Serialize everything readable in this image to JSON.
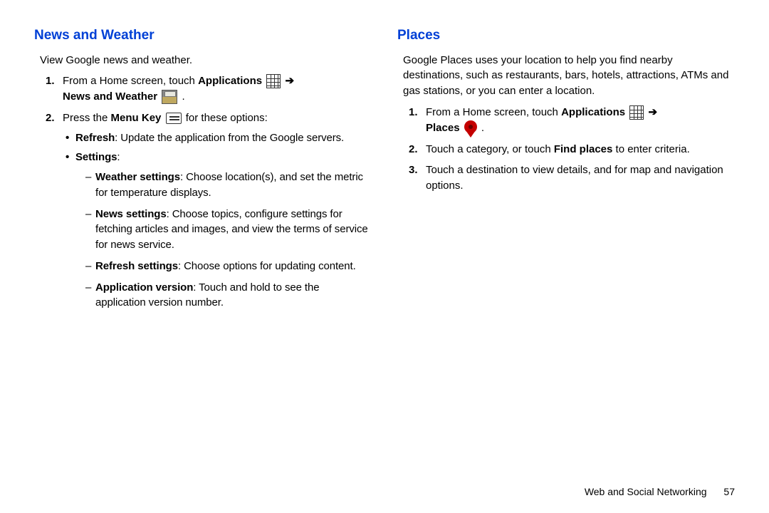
{
  "left": {
    "heading": "News and Weather",
    "intro": "View Google news and weather.",
    "step1_a": "From a Home screen, touch ",
    "step1_apps": "Applications",
    "step1_nw": "News and Weather",
    "step1_end": " .",
    "step2_a": "Press the ",
    "step2_mk": "Menu Key",
    "step2_b": " for these options:",
    "refresh_b": "Refresh",
    "refresh_t": ": Update the application from  the Google servers.",
    "settings_b": "Settings",
    "settings_t": ":",
    "ws_b": "Weather settings",
    "ws_t": ": Choose location(s), and set the metric for temperature displays.",
    "ns_b": "News settings",
    "ns_t": ": Choose topics, configure settings for fetching articles and images, and view the terms of service for news service.",
    "rs_b": "Refresh settings",
    "rs_t": ": Choose options for updating content.",
    "av_b": "Application version",
    "av_t": ": Touch and hold to see the application version number."
  },
  "right": {
    "heading": "Places",
    "intro": "Google Places uses your location to help you find nearby destinations, such as restaurants, bars, hotels, attractions, ATMs and gas stations, or you can enter a location.",
    "step1_a": "From a Home screen, touch ",
    "step1_apps": "Applications",
    "step1_places": "Places",
    "step1_end": " .",
    "step2_a": "Touch a category, or touch ",
    "step2_fp": "Find places",
    "step2_b": " to enter criteria.",
    "step3": "Touch a destination to view details, and for map and navigation options."
  },
  "footer": {
    "section": "Web and Social Networking",
    "page": "57"
  }
}
